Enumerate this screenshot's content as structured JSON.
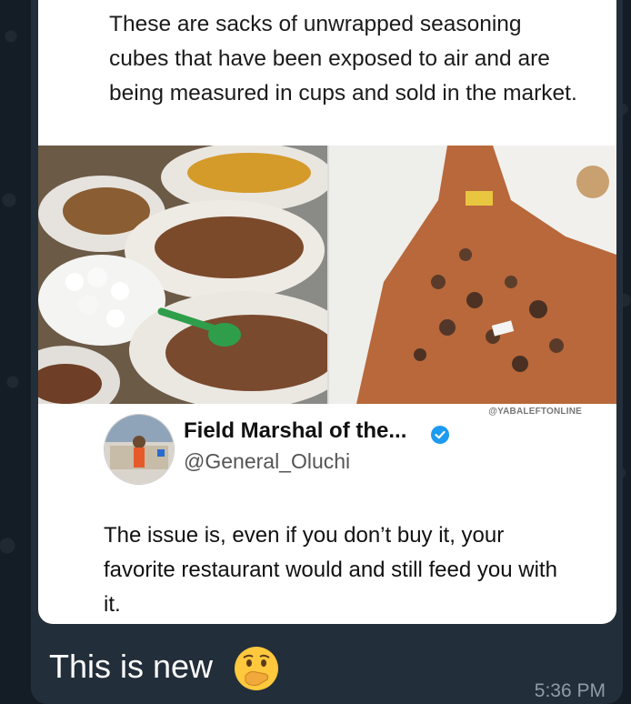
{
  "post": {
    "text": "These are sacks of unwrapped seasoning cubes that have been exposed to air and are being measured in cups and sold in the market.",
    "watermark": "@YABALEFTONLINE"
  },
  "tweet": {
    "name": "Field Marshal of the...",
    "handle": "@General_Oluchi",
    "text": "The issue is, even if you don’t buy it, your favorite restaurant would and still feed you with it."
  },
  "message": {
    "caption": "This is new",
    "time": "5:36 PM"
  },
  "colors": {
    "chat_bg": "#141d26",
    "bubble": "#222e3a",
    "verified": "#1d9bf0"
  }
}
